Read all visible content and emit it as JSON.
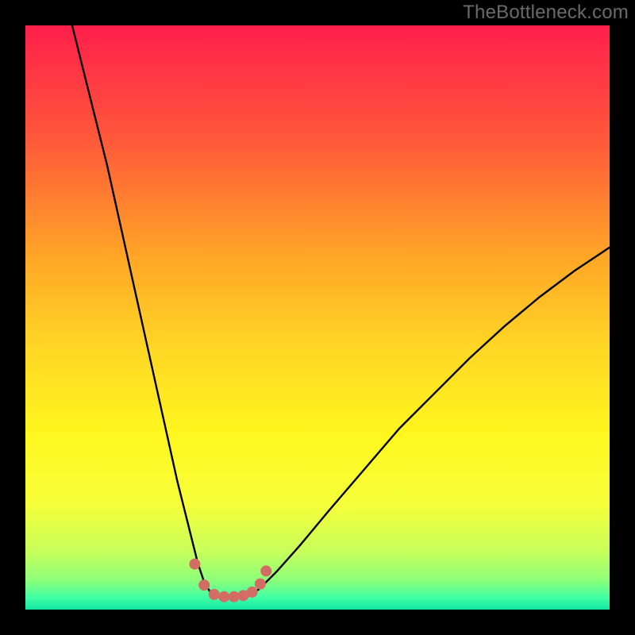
{
  "watermark": "TheBottleneck.com",
  "chart_data": {
    "type": "line",
    "title": "",
    "xlabel": "",
    "ylabel": "",
    "xlim": [
      0,
      100
    ],
    "ylim": [
      0,
      100
    ],
    "grid": false,
    "legend": false,
    "background_gradient": {
      "stops": [
        {
          "offset": 0.0,
          "color": "#ff1e4b"
        },
        {
          "offset": 0.2,
          "color": "#ff5a3a"
        },
        {
          "offset": 0.4,
          "color": "#ffa726"
        },
        {
          "offset": 0.55,
          "color": "#ffd625"
        },
        {
          "offset": 0.7,
          "color": "#fff71e"
        },
        {
          "offset": 0.82,
          "color": "#f6ff3a"
        },
        {
          "offset": 0.9,
          "color": "#c8ff5a"
        },
        {
          "offset": 0.95,
          "color": "#8dff7a"
        },
        {
          "offset": 0.98,
          "color": "#3fffa5"
        },
        {
          "offset": 1.0,
          "color": "#12e6a2"
        }
      ]
    },
    "series": [
      {
        "name": "curve-left",
        "color": "#000000",
        "width": 2.4,
        "x": [
          8,
          10,
          12,
          14,
          16,
          18,
          20,
          22,
          24,
          26,
          28,
          29.5,
          30.5,
          31.5,
          32.5,
          33.5
        ],
        "y": [
          100,
          92,
          84,
          76,
          67,
          58,
          49,
          40,
          31,
          22,
          14,
          8,
          5,
          3.2,
          2.4,
          2.2
        ]
      },
      {
        "name": "curve-right",
        "color": "#000000",
        "width": 2.4,
        "x": [
          38,
          40,
          43,
          47,
          52,
          58,
          64,
          70,
          76,
          82,
          88,
          94,
          100
        ],
        "y": [
          2.2,
          3.5,
          6.5,
          11,
          17,
          24,
          31,
          37,
          43,
          48.5,
          53.5,
          58,
          62
        ]
      },
      {
        "name": "trough-marker",
        "type": "scatter",
        "color": "#d46c66",
        "size": 7,
        "x": [
          29.0,
          30.6,
          32.3,
          34.0,
          35.7,
          37.3,
          38.8,
          40.2,
          41.2
        ],
        "y": [
          7.8,
          4.2,
          2.6,
          2.2,
          2.2,
          2.4,
          3.0,
          4.4,
          6.6
        ]
      }
    ]
  }
}
